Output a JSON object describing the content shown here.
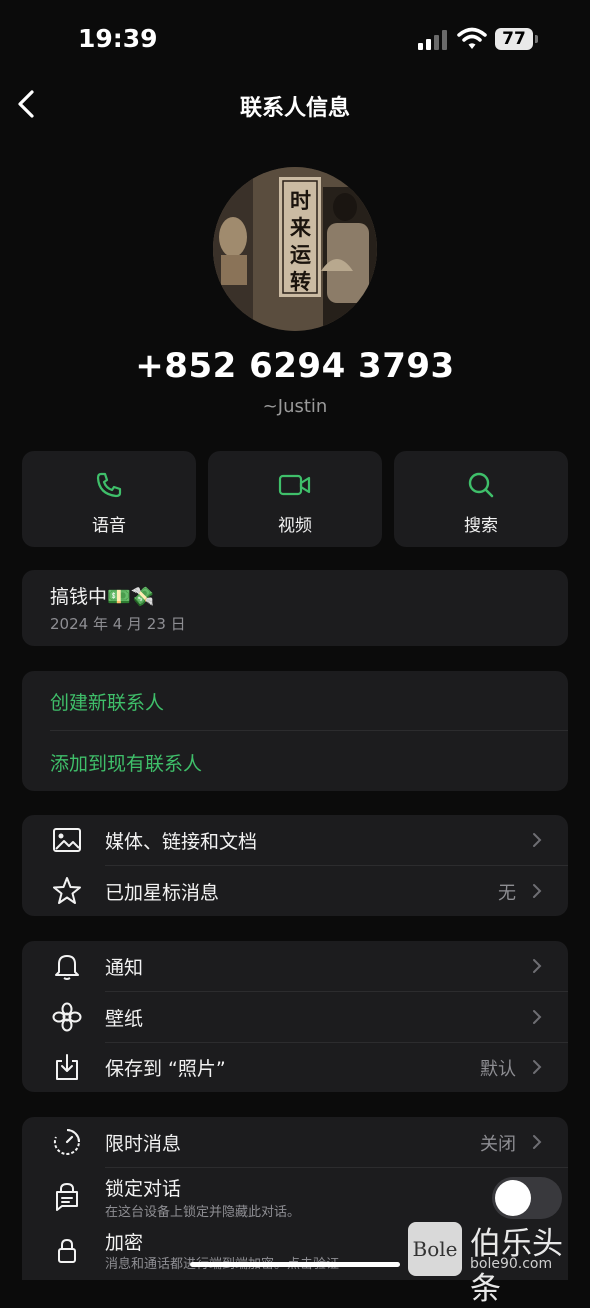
{
  "status_bar": {
    "time": "19:39",
    "battery": "77"
  },
  "nav": {
    "title": "联系人信息"
  },
  "contact": {
    "phone": "+852 6294 3793",
    "alias": "~Justin",
    "avatar_text": "时来运转"
  },
  "actions": [
    {
      "label": "语音",
      "icon": "phone-icon"
    },
    {
      "label": "视频",
      "icon": "video-icon"
    },
    {
      "label": "搜索",
      "icon": "search-icon"
    }
  ],
  "about": {
    "text": "搞钱中💵💸",
    "date": "2024 年 4 月 23 日"
  },
  "contact_actions": {
    "create": "创建新联系人",
    "add_existing": "添加到现有联系人"
  },
  "group1": [
    {
      "label": "媒体、链接和文档",
      "value": "",
      "icon": "image-icon"
    },
    {
      "label": "已加星标消息",
      "value": "无",
      "icon": "star-icon"
    }
  ],
  "group2": [
    {
      "label": "通知",
      "value": "",
      "icon": "bell-icon"
    },
    {
      "label": "壁纸",
      "value": "",
      "icon": "flower-icon"
    },
    {
      "label": "保存到 “照片”",
      "value": "默认",
      "icon": "download-icon"
    }
  ],
  "group3": [
    {
      "label": "限时消息",
      "value": "关闭",
      "icon": "timer-icon"
    },
    {
      "label": "锁定对话",
      "sub": "在这台设备上锁定并隐藏此对话。",
      "icon": "lock-chat-icon",
      "toggle": "off"
    },
    {
      "label": "加密",
      "sub": "消息和通话都进行端到端加密。点击验证",
      "icon": "lock-icon"
    }
  ],
  "watermark": {
    "logo": "Bole",
    "name": "伯乐头条",
    "url": "bole90.com"
  },
  "colors": {
    "accent_green": "#3fbf6a",
    "card": "#1c1c1e",
    "background": "#0b0b0b"
  }
}
